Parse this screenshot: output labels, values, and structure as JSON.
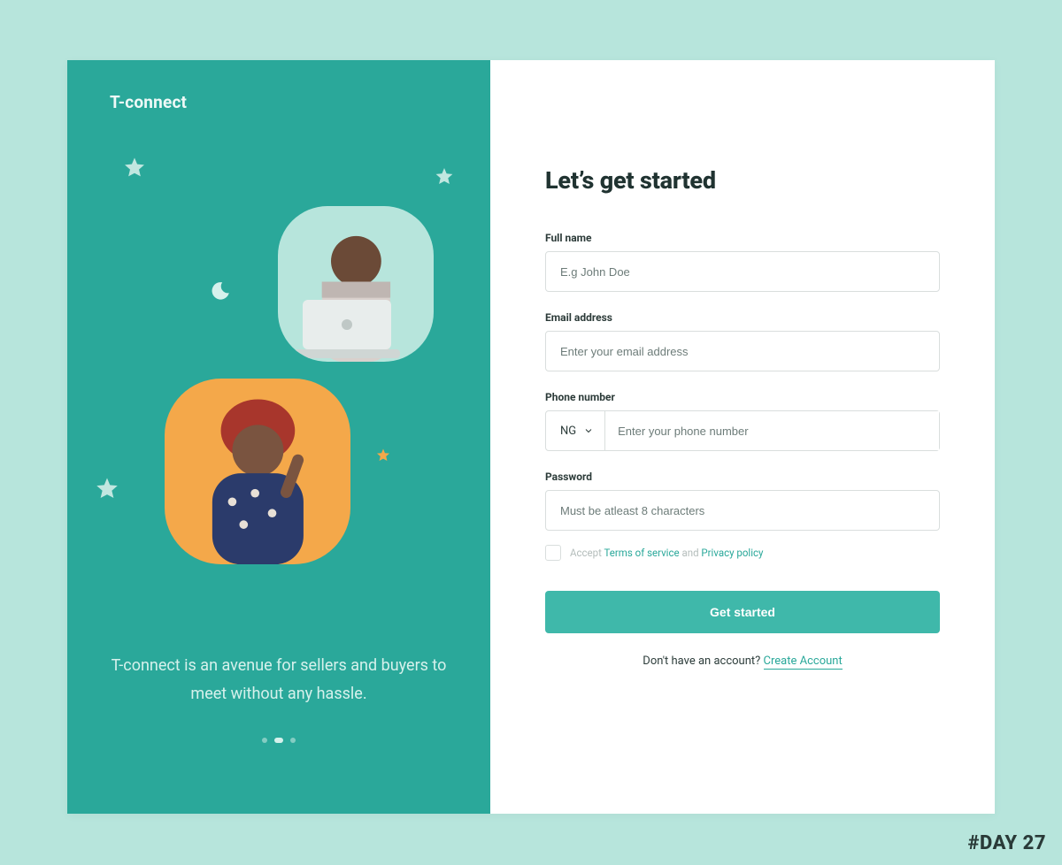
{
  "brand": "T-connect",
  "left": {
    "tagline": "T-connect is an avenue for sellers and buyers to meet without any hassle.",
    "carousel": {
      "count": 3,
      "active_index": 1
    }
  },
  "form": {
    "title": "Let’s get started",
    "fullname": {
      "label": "Full name",
      "placeholder": "E.g John Doe"
    },
    "email": {
      "label": "Email address",
      "placeholder": "Enter your email address"
    },
    "phone": {
      "label": "Phone number",
      "country_code": "NG",
      "placeholder": "Enter your phone number"
    },
    "password": {
      "label": "Password",
      "placeholder": "Must be atleast 8 characters"
    },
    "terms": {
      "prefix": "Accept ",
      "tos": "Terms of service",
      "and": " and ",
      "privacy": "Privacy policy"
    },
    "submit": "Get started",
    "alt": {
      "prompt": "Don't have an account?  ",
      "link": "Create Account"
    }
  },
  "footer_tag": "#DAY 27",
  "colors": {
    "teal": "#2aa89a",
    "mint_bg": "#b7e5dc",
    "orange": "#f4a84a"
  }
}
